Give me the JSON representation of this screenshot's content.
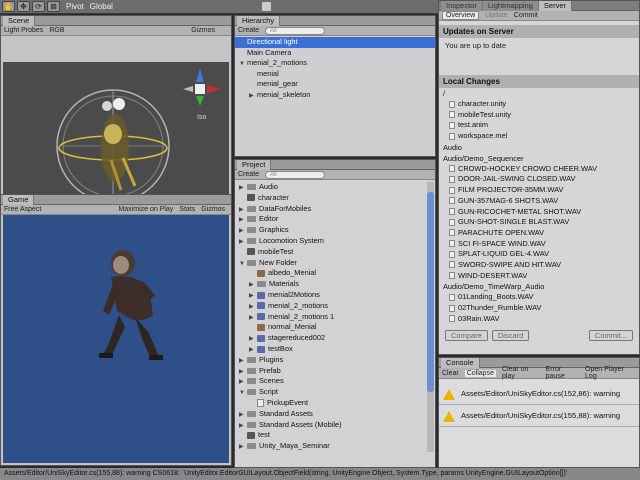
{
  "toolbar": {
    "tools": [
      "hand",
      "move",
      "rotate",
      "scale"
    ],
    "pivot_label": "Pivot",
    "global_label": "Global"
  },
  "scene": {
    "tab": "Scene",
    "subbar": [
      "Light Probes",
      "RGB"
    ],
    "gizmos": "Gizmos",
    "iso_label": "Iso"
  },
  "game": {
    "tab": "Game",
    "aspect": "Free Aspect",
    "maximize": "Maximize on Play",
    "stats": "Stats",
    "gizmos": "Gizmos"
  },
  "hierarchy": {
    "tab": "Hierarchy",
    "create": "Create",
    "search_placeholder": "All",
    "items": [
      {
        "label": "Directional light",
        "depth": 0,
        "arrow": "",
        "selected": true
      },
      {
        "label": "Main Camera",
        "depth": 0,
        "arrow": ""
      },
      {
        "label": "menial_2_motions",
        "depth": 0,
        "arrow": "▼"
      },
      {
        "label": "menial",
        "depth": 1,
        "arrow": ""
      },
      {
        "label": "menial_gear",
        "depth": 1,
        "arrow": ""
      },
      {
        "label": "menial_skeleton",
        "depth": 1,
        "arrow": "▶"
      }
    ]
  },
  "project": {
    "tab": "Project",
    "create": "Create",
    "search_placeholder": "All",
    "items": [
      {
        "label": "Audio",
        "depth": 0,
        "arrow": "▶",
        "icon": "folder"
      },
      {
        "label": "character",
        "depth": 0,
        "arrow": "",
        "icon": "scene"
      },
      {
        "label": "DataForMobiles",
        "depth": 0,
        "arrow": "▶",
        "icon": "folder"
      },
      {
        "label": "Editor",
        "depth": 0,
        "arrow": "▶",
        "icon": "folder"
      },
      {
        "label": "Graphics",
        "depth": 0,
        "arrow": "▶",
        "icon": "folder"
      },
      {
        "label": "Locomotion System",
        "depth": 0,
        "arrow": "▶",
        "icon": "folder"
      },
      {
        "label": "mobileTest",
        "depth": 0,
        "arrow": "",
        "icon": "scene"
      },
      {
        "label": "New Folder",
        "depth": 0,
        "arrow": "▼",
        "icon": "folder"
      },
      {
        "label": "albedo_Menial",
        "depth": 1,
        "arrow": "",
        "icon": "texture"
      },
      {
        "label": "Materials",
        "depth": 1,
        "arrow": "▶",
        "icon": "folder"
      },
      {
        "label": "menial2Motions",
        "depth": 1,
        "arrow": "▶",
        "icon": "model"
      },
      {
        "label": "menial_2_motions",
        "depth": 1,
        "arrow": "▶",
        "icon": "model"
      },
      {
        "label": "menial_2_motions 1",
        "depth": 1,
        "arrow": "▶",
        "icon": "model"
      },
      {
        "label": "normal_Menial",
        "depth": 1,
        "arrow": "",
        "icon": "texture"
      },
      {
        "label": "stagereduced002",
        "depth": 1,
        "arrow": "▶",
        "icon": "model"
      },
      {
        "label": "testBox",
        "depth": 1,
        "arrow": "▶",
        "icon": "model"
      },
      {
        "label": "Plugins",
        "depth": 0,
        "arrow": "▶",
        "icon": "folder"
      },
      {
        "label": "Prefab",
        "depth": 0,
        "arrow": "▶",
        "icon": "folder"
      },
      {
        "label": "Scenes",
        "depth": 0,
        "arrow": "▶",
        "icon": "folder"
      },
      {
        "label": "Script",
        "depth": 0,
        "arrow": "▼",
        "icon": "folder"
      },
      {
        "label": "PickupEvent",
        "depth": 1,
        "arrow": "",
        "icon": "file"
      },
      {
        "label": "Standard Assets",
        "depth": 0,
        "arrow": "▶",
        "icon": "folder"
      },
      {
        "label": "Standard Assets (Mobile)",
        "depth": 0,
        "arrow": "▶",
        "icon": "folder"
      },
      {
        "label": "test",
        "depth": 0,
        "arrow": "",
        "icon": "scene"
      },
      {
        "label": "Unity_Maya_Seminar",
        "depth": 0,
        "arrow": "▶",
        "icon": "folder"
      }
    ]
  },
  "inspector": {
    "tabs": [
      "Inspector",
      "Lightmapping",
      "Server"
    ],
    "subtabs": [
      "Overview",
      "Update",
      "Commit"
    ],
    "updates_title": "Updates on Server",
    "updates_text": "You are up to date",
    "local_title": "Local Changes",
    "changes": [
      {
        "label": "/",
        "type": "head"
      },
      {
        "label": "character.unity",
        "type": "item"
      },
      {
        "label": "mobileTest.unity",
        "type": "item"
      },
      {
        "label": "test.anim",
        "type": "item"
      },
      {
        "label": "workspace.mel",
        "type": "item"
      },
      {
        "label": "Audio",
        "type": "head"
      },
      {
        "label": "Audio/Demo_Sequencer",
        "type": "head"
      },
      {
        "label": "CROWD-HOCKEY CROWD CHEER.WAV",
        "type": "item"
      },
      {
        "label": "DOOR-JAIL-SWING CLOSED.WAV",
        "type": "item"
      },
      {
        "label": "FILM PROJECTOR-35MM.WAV",
        "type": "item"
      },
      {
        "label": "GUN-357MAG-6 SHOTS.WAV",
        "type": "item"
      },
      {
        "label": "GUN-RICOCHET-METAL SHOT.WAV",
        "type": "item"
      },
      {
        "label": "GUN-SHOT-SINGLE BLAST.WAV",
        "type": "item"
      },
      {
        "label": "PARACHUTE OPEN.WAV",
        "type": "item"
      },
      {
        "label": "SCI FI-SPACE WIND.WAV",
        "type": "item"
      },
      {
        "label": "SPLAT-LIQUID GEL-4.WAV",
        "type": "item"
      },
      {
        "label": "SWORD-SWIPE AND HIT.WAV",
        "type": "item"
      },
      {
        "label": "WIND-DESERT.WAV",
        "type": "item"
      },
      {
        "label": "Audio/Demo_TimeWarp_Audio",
        "type": "head"
      },
      {
        "label": "01Landing_Boots.WAV",
        "type": "item"
      },
      {
        "label": "02Thunder_Rumble.WAV",
        "type": "item"
      },
      {
        "label": "03Rain.WAV",
        "type": "item"
      }
    ],
    "compare": "Compare",
    "discard": "Discard",
    "commit": "Commit..."
  },
  "console": {
    "tab": "Console",
    "buttons": [
      "Clear",
      "Collapse",
      "Clear on play",
      "Error pause",
      "Open Player Log"
    ],
    "rows": [
      "Assets/Editor/UniSkyEditor.cs(152,86): warning",
      "Assets/Editor/UniSkyEditor.cs(155,88): warning"
    ]
  },
  "status": {
    "text": "Assets/Editor/UniSkyEditor.cs(155,88): warning CS0618: `UnityEditor.EditorGUILayout.ObjectField(string, UnityEngine.Object, System.Type, params UnityEngine.GUILayoutOption[])'"
  }
}
